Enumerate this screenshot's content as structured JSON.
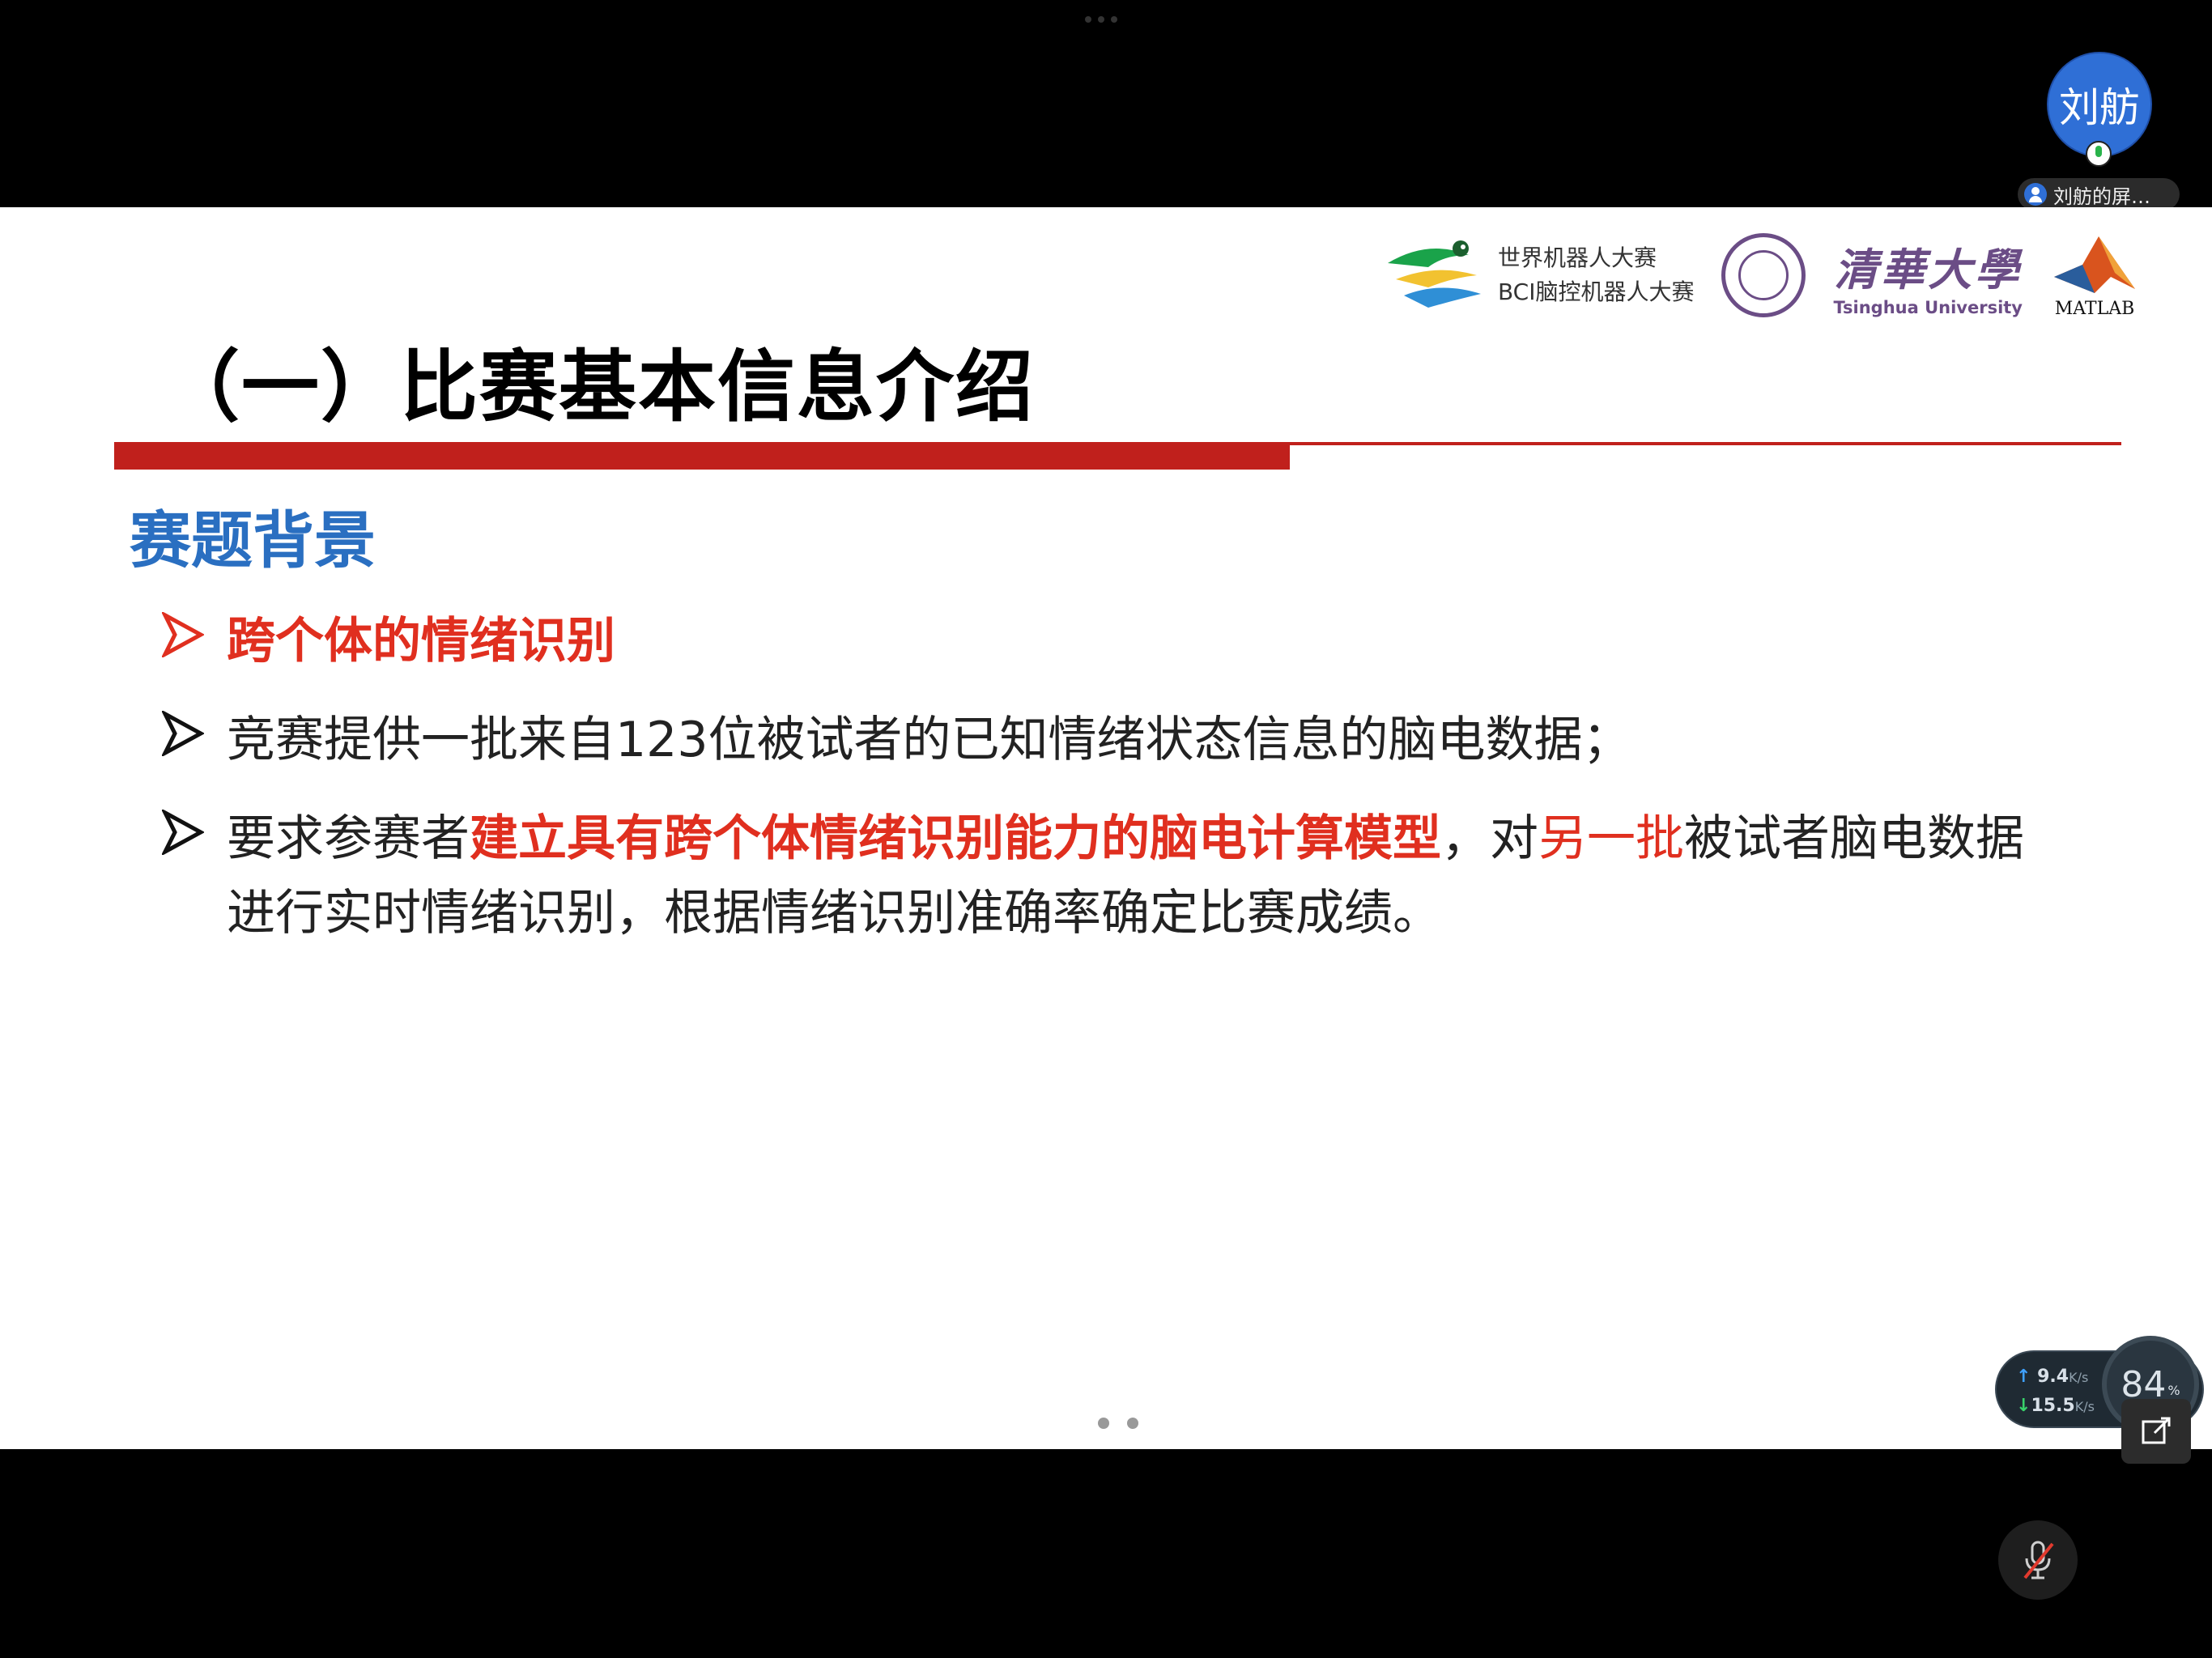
{
  "participant": {
    "avatar_text": "刘舫",
    "screen_share_label": "刘舫的屏…"
  },
  "slide": {
    "logos": {
      "wrc_line1": "世界机器人大赛",
      "wrc_line2": "BCI脑控机器人大赛",
      "tsinghua_cn": "清華大學",
      "tsinghua_en": "Tsinghua University",
      "matlab": "MATLAB"
    },
    "title": "（一）比赛基本信息介绍",
    "section_title": "赛题背景",
    "bullets": [
      {
        "text": "跨个体的情绪识别"
      },
      {
        "text": "竞赛提供一批来自123位被试者的已知情绪状态信息的脑电数据；"
      },
      {
        "part1": "要求参赛者",
        "part2": "建立具有跨个体情绪识别能力的脑电计算模型",
        "part3": "，对",
        "part4": "另一批",
        "part5": "被试者脑电数据进行实时情绪识别，根据情绪识别准确率确定比赛成绩。"
      }
    ]
  },
  "network": {
    "upload": "9.4",
    "upload_unit": "K/s",
    "download": "15.5",
    "download_unit": "K/s",
    "gauge": "84",
    "gauge_unit": "%"
  },
  "colors": {
    "accent_red": "#c0201c",
    "text_red": "#e02f1f",
    "heading_blue": "#2a6fc1",
    "avatar_blue": "#2f6fd6"
  },
  "icons": [
    "user-icon",
    "mic-icon",
    "bullet-arrow-icon",
    "expand-icon",
    "mic-muted-icon"
  ]
}
